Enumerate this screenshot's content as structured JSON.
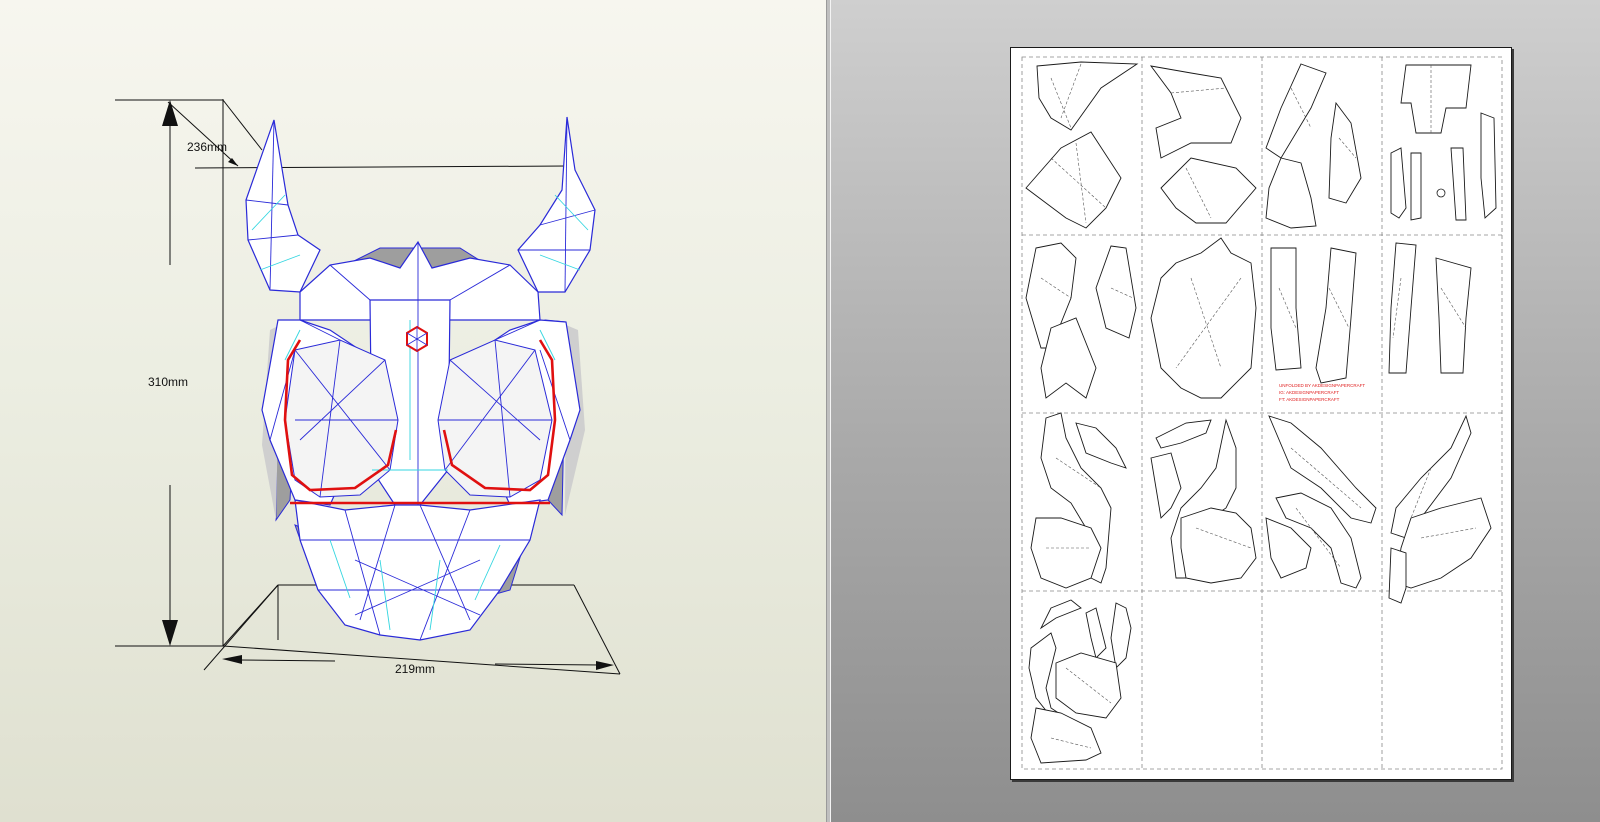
{
  "viewer_3d": {
    "dimensions": {
      "height": "310mm",
      "width": "219mm",
      "depth": "236mm"
    },
    "model_name": "demon-mask",
    "colors": {
      "background_top": "#f7f6ef",
      "background_bottom": "#dfe0d0",
      "mountain_fold_lines": "#2a2ad8",
      "valley_fold_lines": "#33d6e0",
      "selected_edges": "#e01010",
      "faces": "#ffffff",
      "inner_faces": "#9e9e9e"
    }
  },
  "viewer_2d": {
    "page_count": 1,
    "grid": {
      "rows": 4,
      "columns": 4
    },
    "watermark_lines": [
      "UNFOLDED BY AKDESIGNPAPERCRAFT",
      "IG: AKDESIGNPAPERCRAFT",
      "FT: AKDESIGNPAPERCRAFT"
    ],
    "colors": {
      "page": "#ffffff",
      "part_outline": "#1a1a1a",
      "fold_dash": "#555555",
      "watermark": "#e02020"
    }
  }
}
